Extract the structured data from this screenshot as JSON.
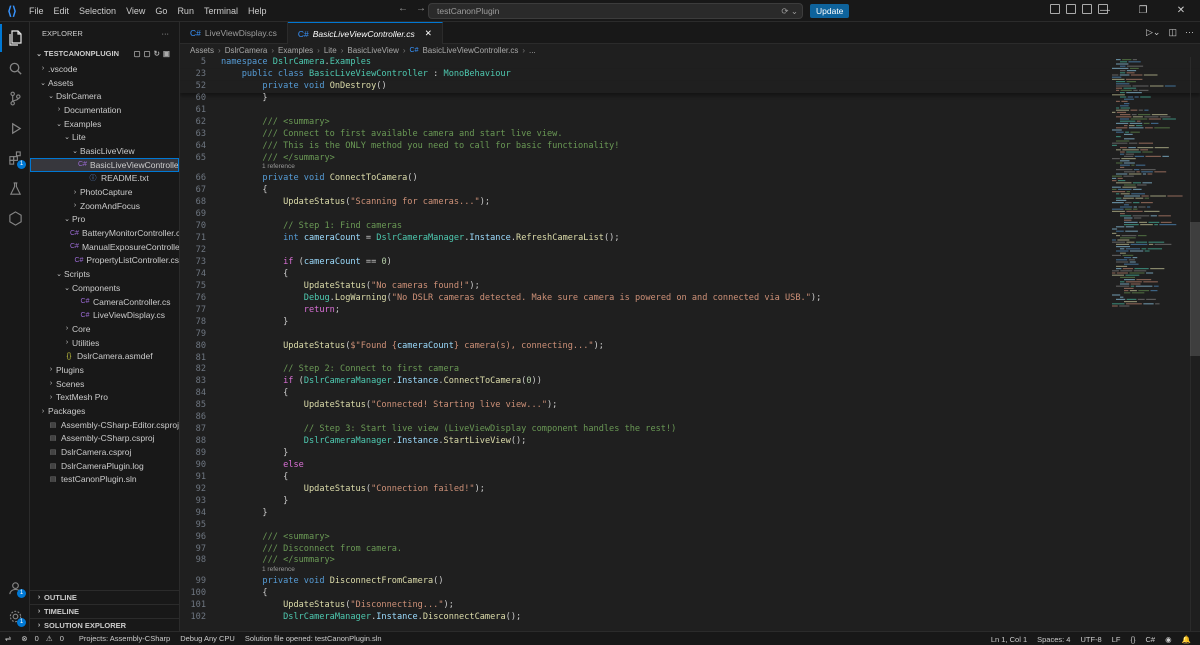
{
  "titlebar": {
    "menu": [
      "File",
      "Edit",
      "Selection",
      "View",
      "Go",
      "Run",
      "Terminal",
      "Help"
    ],
    "search_text": "testCanonPlugin",
    "update_label": "Update"
  },
  "sidebar": {
    "title": "EXPLORER",
    "root": "TESTCANONPLUGIN",
    "items": [
      {
        "label": ".vscode",
        "depth": 1,
        "kind": "folder-closed"
      },
      {
        "label": "Assets",
        "depth": 1,
        "kind": "folder-open"
      },
      {
        "label": "DslrCamera",
        "depth": 2,
        "kind": "folder-open"
      },
      {
        "label": "Documentation",
        "depth": 3,
        "kind": "folder-closed"
      },
      {
        "label": "Examples",
        "depth": 3,
        "kind": "folder-open"
      },
      {
        "label": "Lite",
        "depth": 4,
        "kind": "folder-open"
      },
      {
        "label": "BasicLiveView",
        "depth": 5,
        "kind": "folder-open"
      },
      {
        "label": "BasicLiveViewController.cs",
        "depth": 6,
        "kind": "cs",
        "selected": true
      },
      {
        "label": "README.txt",
        "depth": 6,
        "kind": "txt"
      },
      {
        "label": "PhotoCapture",
        "depth": 5,
        "kind": "folder-closed"
      },
      {
        "label": "ZoomAndFocus",
        "depth": 5,
        "kind": "folder-closed"
      },
      {
        "label": "Pro",
        "depth": 4,
        "kind": "folder-open"
      },
      {
        "label": "BatteryMonitorController.cs",
        "depth": 5,
        "kind": "cs"
      },
      {
        "label": "ManualExposureController.cs",
        "depth": 5,
        "kind": "cs"
      },
      {
        "label": "PropertyListController.cs",
        "depth": 5,
        "kind": "cs"
      },
      {
        "label": "Scripts",
        "depth": 3,
        "kind": "folder-open"
      },
      {
        "label": "Components",
        "depth": 4,
        "kind": "folder-open"
      },
      {
        "label": "CameraController.cs",
        "depth": 5,
        "kind": "cs"
      },
      {
        "label": "LiveViewDisplay.cs",
        "depth": 5,
        "kind": "cs"
      },
      {
        "label": "Core",
        "depth": 4,
        "kind": "folder-closed"
      },
      {
        "label": "Utilities",
        "depth": 4,
        "kind": "folder-closed"
      },
      {
        "label": "DslrCamera.asmdef",
        "depth": 3,
        "kind": "json"
      },
      {
        "label": "Plugins",
        "depth": 2,
        "kind": "folder-closed"
      },
      {
        "label": "Scenes",
        "depth": 2,
        "kind": "folder-closed"
      },
      {
        "label": "TextMesh Pro",
        "depth": 2,
        "kind": "folder-closed"
      },
      {
        "label": "Packages",
        "depth": 1,
        "kind": "folder-closed"
      },
      {
        "label": "Assembly-CSharp-Editor.csproj",
        "depth": 1,
        "kind": "proj"
      },
      {
        "label": "Assembly-CSharp.csproj",
        "depth": 1,
        "kind": "proj"
      },
      {
        "label": "DslrCamera.csproj",
        "depth": 1,
        "kind": "proj"
      },
      {
        "label": "DslrCameraPlugin.log",
        "depth": 1,
        "kind": "log"
      },
      {
        "label": "testCanonPlugin.sln",
        "depth": 1,
        "kind": "sln"
      }
    ],
    "bottom_sections": [
      "OUTLINE",
      "TIMELINE",
      "SOLUTION EXPLORER"
    ]
  },
  "tabs": [
    {
      "label": "LiveViewDisplay.cs",
      "active": false
    },
    {
      "label": "BasicLiveViewController.cs",
      "active": true
    }
  ],
  "breadcrumb": [
    "Assets",
    "DslrCamera",
    "Examples",
    "Lite",
    "BasicLiveView",
    "BasicLiveViewController.cs",
    "..."
  ],
  "activity_badges": {
    "extensions": "1",
    "accounts": "1",
    "manage": "1"
  },
  "statusbar": {
    "errors": "0",
    "warnings": "0",
    "project": "Projects: Assembly-CSharp",
    "config": "Debug Any CPU",
    "message": "Solution file opened: testCanonPlugin.sln",
    "position": "Ln 1, Col 1",
    "spaces": "Spaces: 4",
    "encoding": "UTF-8",
    "eol": "LF",
    "language": "C#"
  },
  "code": {
    "reference_label": "1 reference",
    "lines": [
      {
        "n": "5",
        "sticky": true,
        "html": "<span class=\"kw\">namespace</span> <span class=\"ty\">DslrCamera</span>.<span class=\"ty\">Examples</span>"
      },
      {
        "n": "23",
        "sticky": true,
        "html": "    <span class=\"kw\">public class</span> <span class=\"ty\">BasicLiveViewController</span> : <span class=\"ty\">MonoBehaviour</span>"
      },
      {
        "n": "52",
        "sticky": true,
        "html": "        <span class=\"kw\">private void</span> <span class=\"fn\">OnDestroy</span>()"
      },
      {
        "n": "60",
        "html": "        }"
      },
      {
        "n": "61",
        "html": ""
      },
      {
        "n": "62",
        "html": "        <span class=\"cm\">/// &lt;summary&gt;</span>"
      },
      {
        "n": "63",
        "html": "        <span class=\"cm\">/// Connect to first available camera and start live view.</span>"
      },
      {
        "n": "64",
        "html": "        <span class=\"cm\">/// This is the ONLY method you need to call for basic functionality!</span>"
      },
      {
        "n": "65",
        "html": "        <span class=\"cm\">/// &lt;/summary&gt;</span>",
        "lens": true
      },
      {
        "n": "66",
        "html": "        <span class=\"kw\">private void</span> <span class=\"fn\">ConnectToCamera</span>()"
      },
      {
        "n": "67",
        "html": "        {"
      },
      {
        "n": "68",
        "html": "            <span class=\"fn\">UpdateStatus</span>(<span class=\"st\">\"Scanning for cameras...\"</span>);"
      },
      {
        "n": "69",
        "html": ""
      },
      {
        "n": "70",
        "html": "            <span class=\"cm\">// Step 1: Find cameras</span>"
      },
      {
        "n": "71",
        "html": "            <span class=\"kw\">int</span> <span class=\"vr\">cameraCount</span> = <span class=\"ty\">DslrCameraManager</span>.<span class=\"vr\">Instance</span>.<span class=\"fn\">RefreshCameraList</span>();"
      },
      {
        "n": "72",
        "html": ""
      },
      {
        "n": "73",
        "html": "            <span class=\"pu\">if</span> (<span class=\"vr\">cameraCount</span> == <span class=\"nm\">0</span>)"
      },
      {
        "n": "74",
        "html": "            {"
      },
      {
        "n": "75",
        "html": "                <span class=\"fn\">UpdateStatus</span>(<span class=\"st\">\"No cameras found!\"</span>);"
      },
      {
        "n": "76",
        "html": "                <span class=\"ty\">Debug</span>.<span class=\"fn\">LogWarning</span>(<span class=\"st\">\"No DSLR cameras detected. Make sure camera is powered on and connected via USB.\"</span>);"
      },
      {
        "n": "77",
        "html": "                <span class=\"pu\">return</span>;"
      },
      {
        "n": "78",
        "html": "            }"
      },
      {
        "n": "79",
        "html": ""
      },
      {
        "n": "80",
        "html": "            <span class=\"fn\">UpdateStatus</span>(<span class=\"st\">$\"Found {</span><span class=\"vr\">cameraCount</span><span class=\"st\">} camera(s), connecting...\"</span>);"
      },
      {
        "n": "81",
        "html": ""
      },
      {
        "n": "82",
        "html": "            <span class=\"cm\">// Step 2: Connect to first camera</span>"
      },
      {
        "n": "83",
        "html": "            <span class=\"pu\">if</span> (<span class=\"ty\">DslrCameraManager</span>.<span class=\"vr\">Instance</span>.<span class=\"fn\">ConnectToCamera</span>(<span class=\"nm\">0</span>))"
      },
      {
        "n": "84",
        "html": "            {"
      },
      {
        "n": "85",
        "html": "                <span class=\"fn\">UpdateStatus</span>(<span class=\"st\">\"Connected! Starting live view...\"</span>);"
      },
      {
        "n": "86",
        "html": ""
      },
      {
        "n": "87",
        "html": "                <span class=\"cm\">// Step 3: Start live view (LiveViewDisplay component handles the rest!)</span>"
      },
      {
        "n": "88",
        "html": "                <span class=\"ty\">DslrCameraManager</span>.<span class=\"vr\">Instance</span>.<span class=\"fn\">StartLiveView</span>();"
      },
      {
        "n": "89",
        "html": "            }"
      },
      {
        "n": "90",
        "html": "            <span class=\"pu\">else</span>"
      },
      {
        "n": "91",
        "html": "            {"
      },
      {
        "n": "92",
        "html": "                <span class=\"fn\">UpdateStatus</span>(<span class=\"st\">\"Connection failed!\"</span>);"
      },
      {
        "n": "93",
        "html": "            }"
      },
      {
        "n": "94",
        "html": "        }"
      },
      {
        "n": "95",
        "html": ""
      },
      {
        "n": "96",
        "html": "        <span class=\"cm\">/// &lt;summary&gt;</span>"
      },
      {
        "n": "97",
        "html": "        <span class=\"cm\">/// Disconnect from camera.</span>"
      },
      {
        "n": "98",
        "html": "        <span class=\"cm\">/// &lt;/summary&gt;</span>",
        "lens": true
      },
      {
        "n": "99",
        "html": "        <span class=\"kw\">private void</span> <span class=\"fn\">DisconnectFromCamera</span>()"
      },
      {
        "n": "100",
        "html": "        {"
      },
      {
        "n": "101",
        "html": "            <span class=\"fn\">UpdateStatus</span>(<span class=\"st\">\"Disconnecting...\"</span>);"
      },
      {
        "n": "102",
        "html": "            <span class=\"ty\">DslrCameraManager</span>.<span class=\"vr\">Instance</span>.<span class=\"fn\">DisconnectCamera</span>();"
      }
    ]
  }
}
